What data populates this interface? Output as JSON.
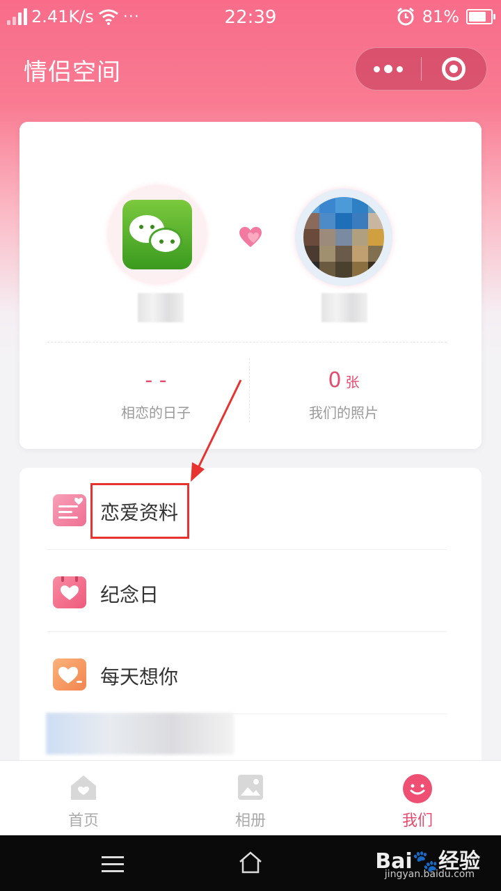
{
  "status_bar": {
    "network_speed": "2.41K/s",
    "more": "···",
    "time": "22:39",
    "battery": "81%",
    "battery_level": 0.81
  },
  "header": {
    "title": "情侣空间"
  },
  "profile": {
    "stats": [
      {
        "value": "- -",
        "unit": "",
        "label": "相恋的日子"
      },
      {
        "value": "0",
        "unit": "张",
        "label": "我们的照片"
      }
    ]
  },
  "menu": {
    "items": [
      {
        "label": "恋爱资料",
        "icon": "love-profile-icon"
      },
      {
        "label": "纪念日",
        "icon": "calendar-heart-icon"
      },
      {
        "label": "每天想你",
        "icon": "heart-message-icon"
      }
    ]
  },
  "tabs": [
    {
      "label": "首页",
      "icon": "home-icon",
      "active": false
    },
    {
      "label": "相册",
      "icon": "album-icon",
      "active": false
    },
    {
      "label": "我们",
      "icon": "smile-icon",
      "active": true
    }
  ],
  "watermark": {
    "brand": "Bai",
    "brand_suffix": "经验",
    "url": "jingyan.baidu.com"
  },
  "colors": {
    "accent": "#e84a6d",
    "header_pink": "#f86c8a",
    "annotation_red": "#e8322f"
  }
}
